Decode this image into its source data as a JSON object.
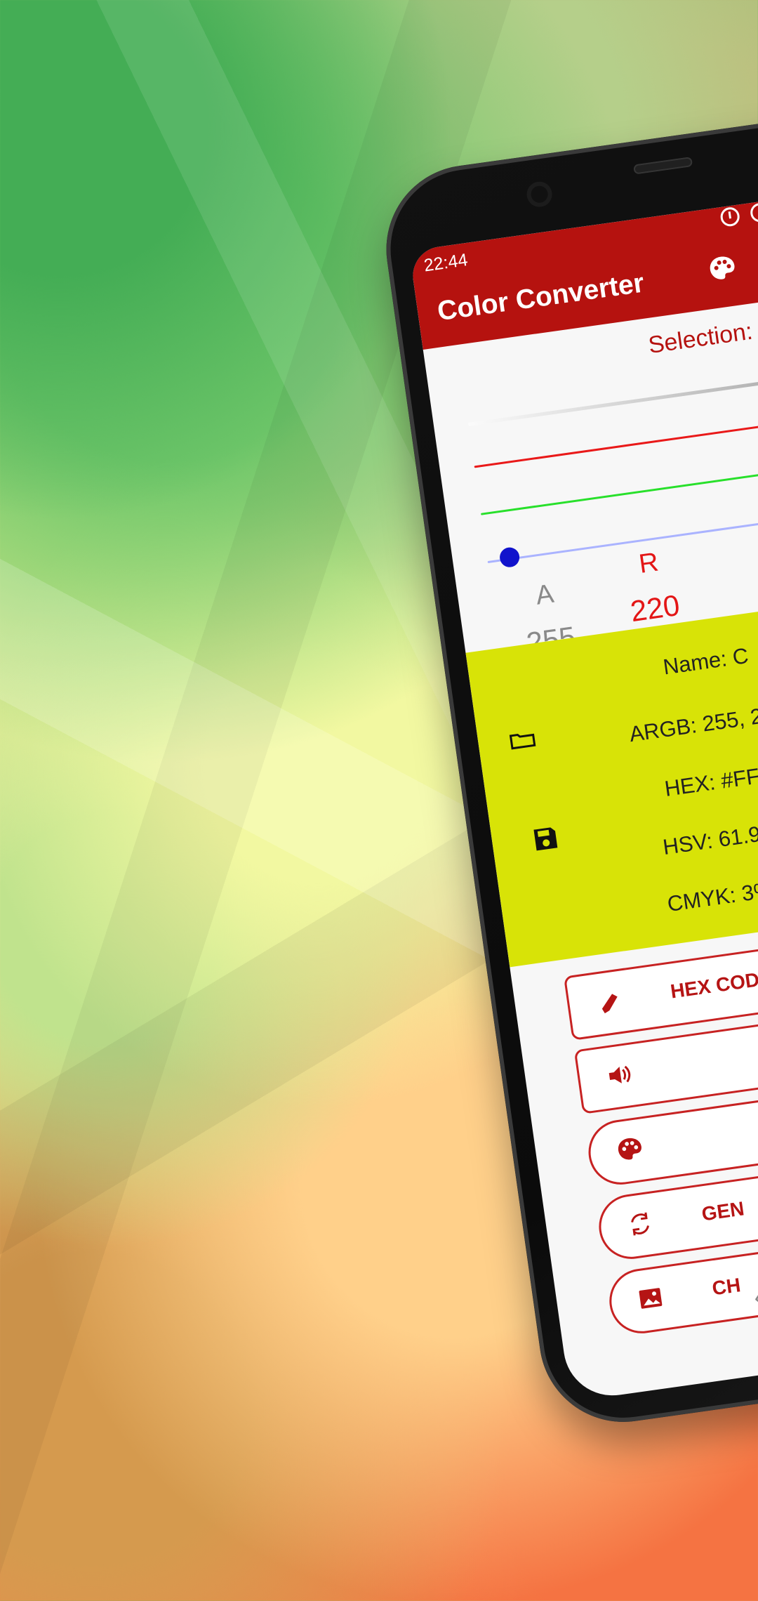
{
  "status": {
    "time": "22:44"
  },
  "app": {
    "title": "Color Converter"
  },
  "selection": {
    "title": "Selection:"
  },
  "channels": {
    "a": {
      "label": "A",
      "value": "255"
    },
    "r": {
      "label": "R",
      "value": "220"
    }
  },
  "info": {
    "name": "Name: C",
    "argb": "ARGB: 255, 2",
    "hex": "HEX: #FF",
    "hsv": "HSV: 61.9",
    "cmyk": "CMYK: 3%,"
  },
  "buttons": {
    "hex_code": "HEX CODE",
    "generate": "GEN",
    "change": "CH"
  },
  "colors": {
    "accent": "#b5120f",
    "selected_fill": "#d8e307",
    "red": "#e31616",
    "green": "#28e02b",
    "blue": "#1113cc"
  },
  "icons": {
    "top_right": "palette-icon",
    "panel_left_top": "folder-icon",
    "panel_left_bottom": "save-icon",
    "button_hex": "pencil-icon",
    "button_sound": "speaker-icon",
    "button_palette": "palette-icon",
    "button_generate": "refresh-icon",
    "button_change": "image-icon"
  }
}
